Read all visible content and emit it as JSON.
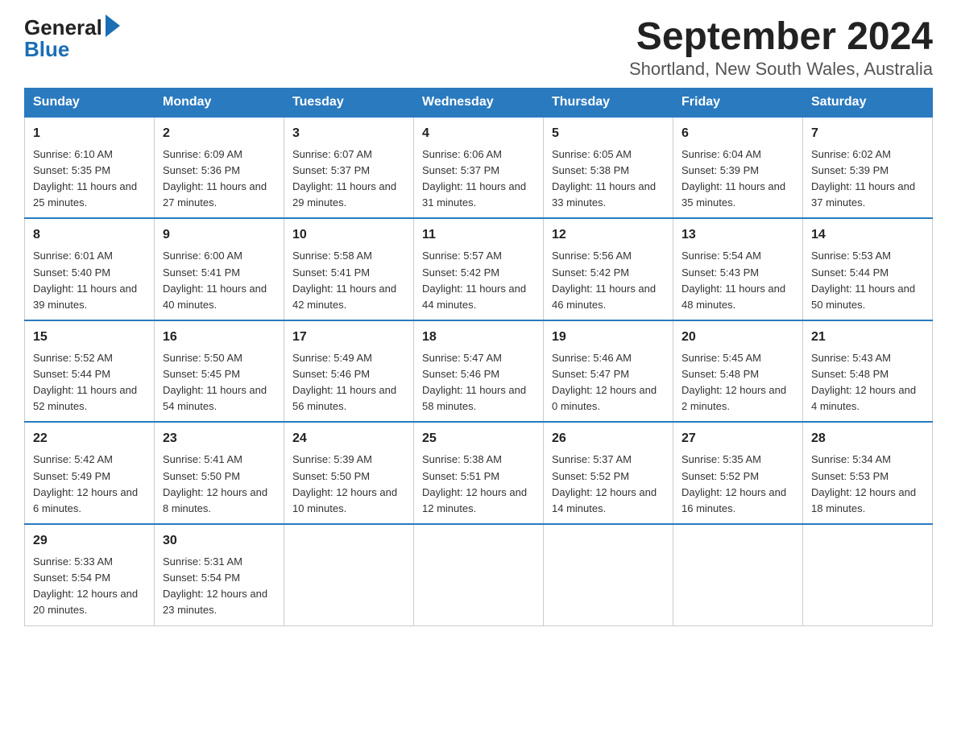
{
  "header": {
    "logo_general": "General",
    "logo_blue": "Blue",
    "title": "September 2024",
    "subtitle": "Shortland, New South Wales, Australia"
  },
  "days_of_week": [
    "Sunday",
    "Monday",
    "Tuesday",
    "Wednesday",
    "Thursday",
    "Friday",
    "Saturday"
  ],
  "weeks": [
    [
      {
        "day": "1",
        "sunrise": "6:10 AM",
        "sunset": "5:35 PM",
        "daylight": "11 hours and 25 minutes."
      },
      {
        "day": "2",
        "sunrise": "6:09 AM",
        "sunset": "5:36 PM",
        "daylight": "11 hours and 27 minutes."
      },
      {
        "day": "3",
        "sunrise": "6:07 AM",
        "sunset": "5:37 PM",
        "daylight": "11 hours and 29 minutes."
      },
      {
        "day": "4",
        "sunrise": "6:06 AM",
        "sunset": "5:37 PM",
        "daylight": "11 hours and 31 minutes."
      },
      {
        "day": "5",
        "sunrise": "6:05 AM",
        "sunset": "5:38 PM",
        "daylight": "11 hours and 33 minutes."
      },
      {
        "day": "6",
        "sunrise": "6:04 AM",
        "sunset": "5:39 PM",
        "daylight": "11 hours and 35 minutes."
      },
      {
        "day": "7",
        "sunrise": "6:02 AM",
        "sunset": "5:39 PM",
        "daylight": "11 hours and 37 minutes."
      }
    ],
    [
      {
        "day": "8",
        "sunrise": "6:01 AM",
        "sunset": "5:40 PM",
        "daylight": "11 hours and 39 minutes."
      },
      {
        "day": "9",
        "sunrise": "6:00 AM",
        "sunset": "5:41 PM",
        "daylight": "11 hours and 40 minutes."
      },
      {
        "day": "10",
        "sunrise": "5:58 AM",
        "sunset": "5:41 PM",
        "daylight": "11 hours and 42 minutes."
      },
      {
        "day": "11",
        "sunrise": "5:57 AM",
        "sunset": "5:42 PM",
        "daylight": "11 hours and 44 minutes."
      },
      {
        "day": "12",
        "sunrise": "5:56 AM",
        "sunset": "5:42 PM",
        "daylight": "11 hours and 46 minutes."
      },
      {
        "day": "13",
        "sunrise": "5:54 AM",
        "sunset": "5:43 PM",
        "daylight": "11 hours and 48 minutes."
      },
      {
        "day": "14",
        "sunrise": "5:53 AM",
        "sunset": "5:44 PM",
        "daylight": "11 hours and 50 minutes."
      }
    ],
    [
      {
        "day": "15",
        "sunrise": "5:52 AM",
        "sunset": "5:44 PM",
        "daylight": "11 hours and 52 minutes."
      },
      {
        "day": "16",
        "sunrise": "5:50 AM",
        "sunset": "5:45 PM",
        "daylight": "11 hours and 54 minutes."
      },
      {
        "day": "17",
        "sunrise": "5:49 AM",
        "sunset": "5:46 PM",
        "daylight": "11 hours and 56 minutes."
      },
      {
        "day": "18",
        "sunrise": "5:47 AM",
        "sunset": "5:46 PM",
        "daylight": "11 hours and 58 minutes."
      },
      {
        "day": "19",
        "sunrise": "5:46 AM",
        "sunset": "5:47 PM",
        "daylight": "12 hours and 0 minutes."
      },
      {
        "day": "20",
        "sunrise": "5:45 AM",
        "sunset": "5:48 PM",
        "daylight": "12 hours and 2 minutes."
      },
      {
        "day": "21",
        "sunrise": "5:43 AM",
        "sunset": "5:48 PM",
        "daylight": "12 hours and 4 minutes."
      }
    ],
    [
      {
        "day": "22",
        "sunrise": "5:42 AM",
        "sunset": "5:49 PM",
        "daylight": "12 hours and 6 minutes."
      },
      {
        "day": "23",
        "sunrise": "5:41 AM",
        "sunset": "5:50 PM",
        "daylight": "12 hours and 8 minutes."
      },
      {
        "day": "24",
        "sunrise": "5:39 AM",
        "sunset": "5:50 PM",
        "daylight": "12 hours and 10 minutes."
      },
      {
        "day": "25",
        "sunrise": "5:38 AM",
        "sunset": "5:51 PM",
        "daylight": "12 hours and 12 minutes."
      },
      {
        "day": "26",
        "sunrise": "5:37 AM",
        "sunset": "5:52 PM",
        "daylight": "12 hours and 14 minutes."
      },
      {
        "day": "27",
        "sunrise": "5:35 AM",
        "sunset": "5:52 PM",
        "daylight": "12 hours and 16 minutes."
      },
      {
        "day": "28",
        "sunrise": "5:34 AM",
        "sunset": "5:53 PM",
        "daylight": "12 hours and 18 minutes."
      }
    ],
    [
      {
        "day": "29",
        "sunrise": "5:33 AM",
        "sunset": "5:54 PM",
        "daylight": "12 hours and 20 minutes."
      },
      {
        "day": "30",
        "sunrise": "5:31 AM",
        "sunset": "5:54 PM",
        "daylight": "12 hours and 23 minutes."
      },
      null,
      null,
      null,
      null,
      null
    ]
  ]
}
